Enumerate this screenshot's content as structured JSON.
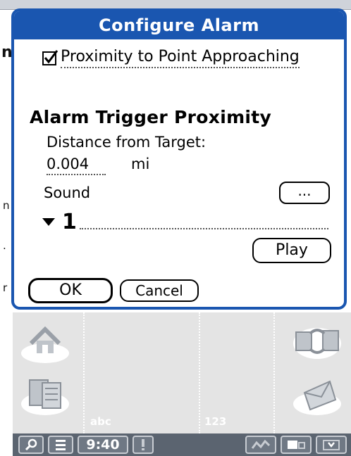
{
  "dialog": {
    "title": "Configure Alarm",
    "checkbox": {
      "label": "Proximity to Point Approaching",
      "checked": true
    },
    "section_heading": "Alarm Trigger Proximity",
    "distance_label": "Distance from Target:",
    "distance_value": "0.004",
    "distance_unit": "mi",
    "sound_label": "Sound",
    "more_button": "...",
    "sound_selected": "1",
    "play_button": "Play",
    "ok_button": "OK",
    "cancel_button": "Cancel"
  },
  "background": {
    "fragments": [
      "n",
      "n",
      ".",
      "r"
    ]
  },
  "graffiti": {
    "letters_label": "abc",
    "numbers_label": "123",
    "icons": [
      "home-icon",
      "applications-icon",
      "sync-icon",
      "mail-icon"
    ]
  },
  "statusbar": {
    "time": "9:40",
    "icons": [
      "find-icon",
      "menu-icon",
      "alert-icon",
      "signal-icon",
      "battery-icon",
      "input-icon"
    ]
  },
  "colors": {
    "dialog_frame": "#1a56b0",
    "graffiti_bg": "#e4e4e4",
    "statusbar_bg": "#5b6470"
  }
}
